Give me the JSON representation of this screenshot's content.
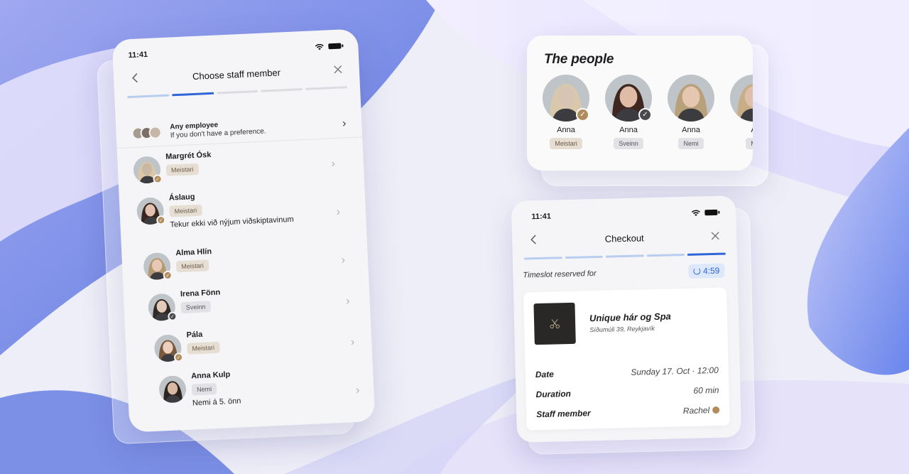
{
  "colors": {
    "accent": "#2f65d6",
    "badge_gold_bg": "#e6ded3",
    "badge_gold_text": "#6b5c48",
    "verified_gold": "#b08d5b"
  },
  "staff_screen": {
    "status_time": "11:41",
    "title": "Choose staff member",
    "back_icon": "chevron-left-icon",
    "close_icon": "close-icon",
    "progress_total": 5,
    "progress_step": 2,
    "any_employee": {
      "title": "Any employee",
      "subtitle": "If you don't have a preference."
    },
    "staff": [
      {
        "name": "Margrét Ósk",
        "role": "Meistari",
        "note": "",
        "verified": "gold",
        "face_color": "#c9b8a6",
        "hair": "#d9c7a8"
      },
      {
        "name": "Áslaug",
        "role": "Meistari",
        "note": "Tekur ekki við nýjum viðskiptavinum",
        "verified": "gold",
        "face_color": "#e3c1b0",
        "hair": "#3a2620"
      },
      {
        "name": "Alma Hlín",
        "role": "Meistari",
        "note": "",
        "verified": "gold",
        "face_color": "#e6c8b4",
        "hair": "#b39a72"
      },
      {
        "name": "Irena Fönn",
        "role": "Sveinn",
        "note": "",
        "verified": "dark",
        "face_color": "#e3c9b8",
        "hair": "#2f2a27"
      },
      {
        "name": "Pála",
        "role": "Meistari",
        "note": "",
        "verified": "gold",
        "face_color": "#ecd0bd",
        "hair": "#7a5a3e"
      },
      {
        "name": "Anna Kulp",
        "role": "Nemi",
        "note": "Nemi á 5. önn",
        "verified": "",
        "face_color": "#d9b9a4",
        "hair": "#2b2420"
      }
    ]
  },
  "people_card": {
    "title": "The people",
    "people": [
      {
        "name": "Anna",
        "role": "Meistari",
        "verified": "gold",
        "face_color": "#d8c4b3",
        "hair": "#d8c9ad"
      },
      {
        "name": "Anna",
        "role": "Sveinn",
        "verified": "dark",
        "face_color": "#e0bca7",
        "hair": "#3d2720"
      },
      {
        "name": "Anna",
        "role": "Nemi",
        "verified": "",
        "face_color": "#e4c6b1",
        "hair": "#b8a07a"
      },
      {
        "name": "A",
        "role": "M",
        "verified": "",
        "face_color": "#dcc0ad",
        "hair": "#c8ad86"
      }
    ]
  },
  "checkout": {
    "status_time": "11:41",
    "title": "Checkout",
    "progress_total": 5,
    "progress_step": 5,
    "timeslot_label": "Timeslot reserved for",
    "timer": "4:59",
    "salon_name": "Unique hár og Spa",
    "salon_address": "Síðumúli 39, Reykjavík",
    "details": [
      {
        "label": "Date",
        "value": "Sunday 17. Oct · 12:00"
      },
      {
        "label": "Duration",
        "value": "60 min"
      },
      {
        "label": "Staff member",
        "value": "Rachel"
      }
    ]
  }
}
